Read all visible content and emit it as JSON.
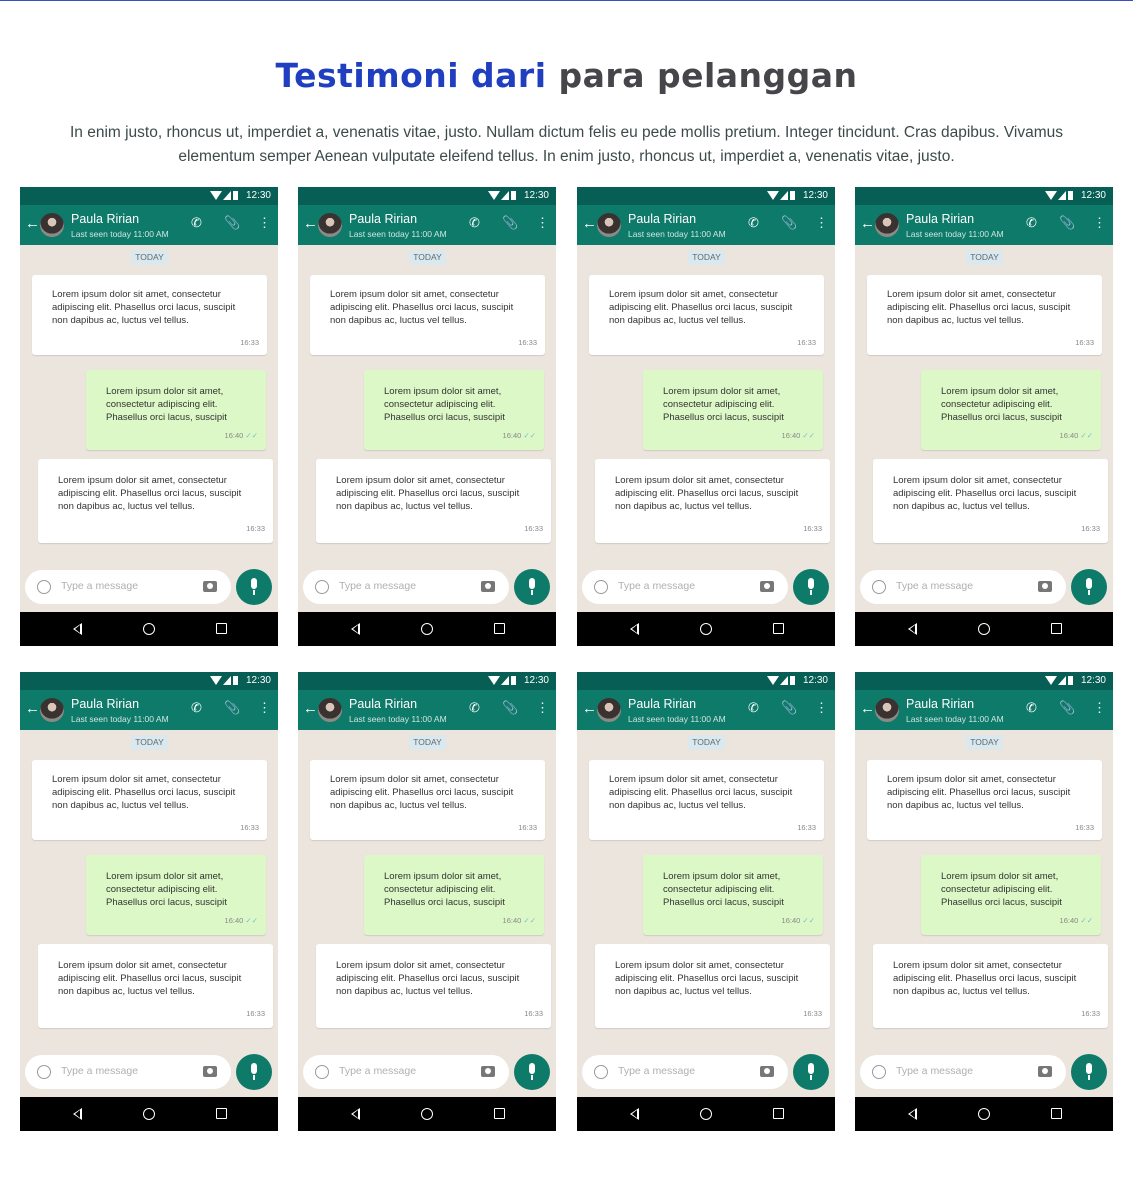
{
  "header": {
    "title_highlight": "Testimoni dari",
    "title_rest": "para pelanggan",
    "subtitle": "In enim justo, rhoncus ut, imperdiet a, venenatis vitae, justo. Nullam dictum felis eu pede mollis pretium. Integer tincidunt. Cras dapibus. Vivamus elementum semper Aenean vulputate eleifend tellus. In enim justo, rhoncus ut, imperdiet a, venenatis vitae, justo."
  },
  "colors": {
    "accent_blue": "#1f3fc0",
    "whatsapp_green": "#0e7a6a",
    "outgoing_bubble": "#dcf8c6",
    "chat_background": "#ece5dd"
  },
  "phones": [
    {
      "status_time": "12:30",
      "contact_name": "Paula Ririan",
      "last_seen": "Last seen today 11:00 AM",
      "date_chip": "TODAY",
      "messages": [
        {
          "text": "Lorem ipsum dolor sit amet, consectetur adipiscing elit. Phasellus orci lacus, suscipit non dapibus ac, luctus vel tellus.",
          "time": "16:33",
          "direction": "incoming"
        },
        {
          "text": "Lorem ipsum dolor sit amet, consectetur adipiscing elit. Phasellus orci lacus, suscipit",
          "time": "16:40",
          "direction": "outgoing"
        },
        {
          "text": "Lorem ipsum dolor sit amet, consectetur adipiscing elit. Phasellus orci lacus, suscipit non dapibus ac, luctus vel tellus.",
          "time": "16:33",
          "direction": "incoming"
        }
      ],
      "input_placeholder": "Type a message"
    },
    {
      "status_time": "12:30",
      "contact_name": "Paula Ririan",
      "last_seen": "Last seen today 11:00 AM",
      "date_chip": "TODAY",
      "messages": [
        {
          "text": "Lorem ipsum dolor sit amet, consectetur adipiscing elit. Phasellus orci lacus, suscipit non dapibus ac, luctus vel tellus.",
          "time": "16:33",
          "direction": "incoming"
        },
        {
          "text": "Lorem ipsum dolor sit amet, consectetur adipiscing elit. Phasellus orci lacus, suscipit",
          "time": "16:40",
          "direction": "outgoing"
        },
        {
          "text": "Lorem ipsum dolor sit amet, consectetur adipiscing elit. Phasellus orci lacus, suscipit non dapibus ac, luctus vel tellus.",
          "time": "16:33",
          "direction": "incoming"
        }
      ],
      "input_placeholder": "Type a message"
    },
    {
      "status_time": "12:30",
      "contact_name": "Paula Ririan",
      "last_seen": "Last seen today 11:00 AM",
      "date_chip": "TODAY",
      "messages": [
        {
          "text": "Lorem ipsum dolor sit amet, consectetur adipiscing elit. Phasellus orci lacus, suscipit non dapibus ac, luctus vel tellus.",
          "time": "16:33",
          "direction": "incoming"
        },
        {
          "text": "Lorem ipsum dolor sit amet, consectetur adipiscing elit. Phasellus orci lacus, suscipit",
          "time": "16:40",
          "direction": "outgoing"
        },
        {
          "text": "Lorem ipsum dolor sit amet, consectetur adipiscing elit. Phasellus orci lacus, suscipit non dapibus ac, luctus vel tellus.",
          "time": "16:33",
          "direction": "incoming"
        }
      ],
      "input_placeholder": "Type a message"
    },
    {
      "status_time": "12:30",
      "contact_name": "Paula Ririan",
      "last_seen": "Last seen today 11:00 AM",
      "date_chip": "TODAY",
      "messages": [
        {
          "text": "Lorem ipsum dolor sit amet, consectetur adipiscing elit. Phasellus orci lacus, suscipit non dapibus ac, luctus vel tellus.",
          "time": "16:33",
          "direction": "incoming"
        },
        {
          "text": "Lorem ipsum dolor sit amet, consectetur adipiscing elit. Phasellus orci lacus, suscipit",
          "time": "16:40",
          "direction": "outgoing"
        },
        {
          "text": "Lorem ipsum dolor sit amet, consectetur adipiscing elit. Phasellus orci lacus, suscipit non dapibus ac, luctus vel tellus.",
          "time": "16:33",
          "direction": "incoming"
        }
      ],
      "input_placeholder": "Type a message"
    },
    {
      "status_time": "12:30",
      "contact_name": "Paula Ririan",
      "last_seen": "Last seen today 11:00 AM",
      "date_chip": "TODAY",
      "messages": [
        {
          "text": "Lorem ipsum dolor sit amet, consectetur adipiscing elit. Phasellus orci lacus, suscipit non dapibus ac, luctus vel tellus.",
          "time": "16:33",
          "direction": "incoming"
        },
        {
          "text": "Lorem ipsum dolor sit amet, consectetur adipiscing elit. Phasellus orci lacus, suscipit",
          "time": "16:40",
          "direction": "outgoing"
        },
        {
          "text": "Lorem ipsum dolor sit amet, consectetur adipiscing elit. Phasellus orci lacus, suscipit non dapibus ac, luctus vel tellus.",
          "time": "16:33",
          "direction": "incoming"
        }
      ],
      "input_placeholder": "Type a message"
    },
    {
      "status_time": "12:30",
      "contact_name": "Paula Ririan",
      "last_seen": "Last seen today 11:00 AM",
      "date_chip": "TODAY",
      "messages": [
        {
          "text": "Lorem ipsum dolor sit amet, consectetur adipiscing elit. Phasellus orci lacus, suscipit non dapibus ac, luctus vel tellus.",
          "time": "16:33",
          "direction": "incoming"
        },
        {
          "text": "Lorem ipsum dolor sit amet, consectetur adipiscing elit. Phasellus orci lacus, suscipit",
          "time": "16:40",
          "direction": "outgoing"
        },
        {
          "text": "Lorem ipsum dolor sit amet, consectetur adipiscing elit. Phasellus orci lacus, suscipit non dapibus ac, luctus vel tellus.",
          "time": "16:33",
          "direction": "incoming"
        }
      ],
      "input_placeholder": "Type a message"
    },
    {
      "status_time": "12:30",
      "contact_name": "Paula Ririan",
      "last_seen": "Last seen today 11:00 AM",
      "date_chip": "TODAY",
      "messages": [
        {
          "text": "Lorem ipsum dolor sit amet, consectetur adipiscing elit. Phasellus orci lacus, suscipit non dapibus ac, luctus vel tellus.",
          "time": "16:33",
          "direction": "incoming"
        },
        {
          "text": "Lorem ipsum dolor sit amet, consectetur adipiscing elit. Phasellus orci lacus, suscipit",
          "time": "16:40",
          "direction": "outgoing"
        },
        {
          "text": "Lorem ipsum dolor sit amet, consectetur adipiscing elit. Phasellus orci lacus, suscipit non dapibus ac, luctus vel tellus.",
          "time": "16:33",
          "direction": "incoming"
        }
      ],
      "input_placeholder": "Type a message"
    },
    {
      "status_time": "12:30",
      "contact_name": "Paula Ririan",
      "last_seen": "Last seen today 11:00 AM",
      "date_chip": "TODAY",
      "messages": [
        {
          "text": "Lorem ipsum dolor sit amet, consectetur adipiscing elit. Phasellus orci lacus, suscipit non dapibus ac, luctus vel tellus.",
          "time": "16:33",
          "direction": "incoming"
        },
        {
          "text": "Lorem ipsum dolor sit amet, consectetur adipiscing elit. Phasellus orci lacus, suscipit",
          "time": "16:40",
          "direction": "outgoing"
        },
        {
          "text": "Lorem ipsum dolor sit amet, consectetur adipiscing elit. Phasellus orci lacus, suscipit non dapibus ac, luctus vel tellus.",
          "time": "16:33",
          "direction": "incoming"
        }
      ],
      "input_placeholder": "Type a message"
    }
  ]
}
